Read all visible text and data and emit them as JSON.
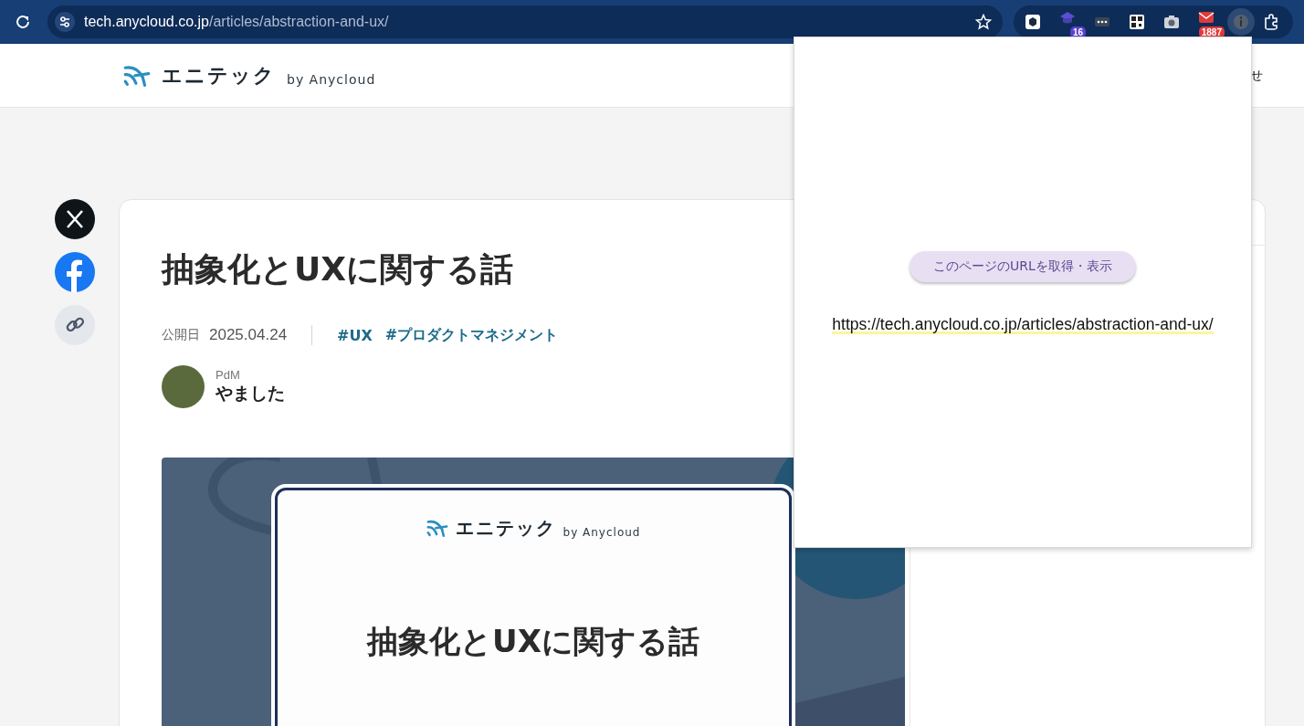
{
  "browser": {
    "url_host": "tech.anycloud.co.jp",
    "url_path": "/articles/abstraction-and-ux/",
    "extensions": [
      {
        "kind": "hexagon"
      },
      {
        "kind": "cap",
        "badge": "16"
      },
      {
        "kind": "dots"
      },
      {
        "kind": "qr"
      },
      {
        "kind": "camera"
      },
      {
        "kind": "mail",
        "badge": "1887"
      },
      {
        "kind": "info",
        "selected": true
      }
    ]
  },
  "header": {
    "logo": "エニテック",
    "logo_sub": "by Anycloud",
    "nav_item": "せ"
  },
  "share": [
    {
      "kind": "x"
    },
    {
      "kind": "facebook"
    },
    {
      "kind": "link"
    }
  ],
  "article": {
    "title": "抽象化とUXに関する話",
    "date_label": "公開日",
    "date": "2025.04.24",
    "tags": [
      "#UX",
      "#プロダクトマネジメント"
    ],
    "author_role": "PdM",
    "author_name": "やました",
    "hero": {
      "logo": "エニテック",
      "logo_sub": "by Anycloud",
      "title": "抽象化とUXに関する話"
    }
  },
  "popup": {
    "button": "このページのURLを取得・表示",
    "url": "https://tech.anycloud.co.jp/articles/abstraction-and-ux/"
  }
}
